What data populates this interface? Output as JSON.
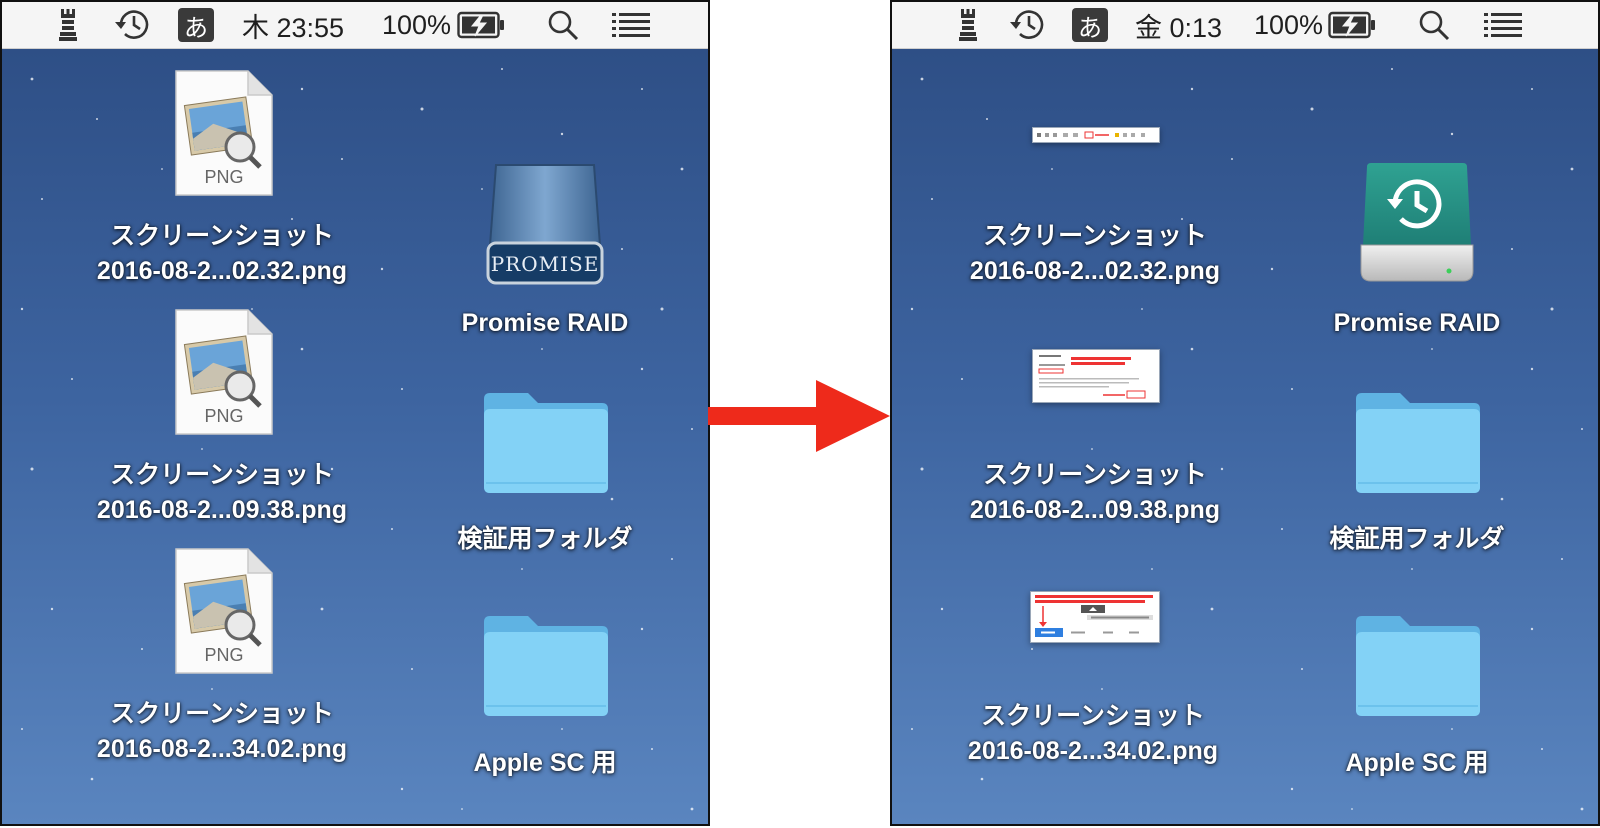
{
  "before": {
    "menubar": {
      "ime_label": "あ",
      "clock": "木 23:55",
      "battery_percent": "100%",
      "icons": [
        "tower-icon",
        "time-machine-icon",
        "ime-icon",
        "battery-charging-icon",
        "spotlight-search-icon",
        "notification-list-icon"
      ]
    },
    "files": [
      {
        "name_line1": "スクリーンショット",
        "name_line2": "2016-08-2...02.32.png",
        "type_label": "PNG"
      },
      {
        "name_line1": "スクリーンショット",
        "name_line2": "2016-08-2...09.38.png",
        "type_label": "PNG"
      },
      {
        "name_line1": "スクリーンショット",
        "name_line2": "2016-08-2...34.02.png",
        "type_label": "PNG"
      }
    ],
    "drive": {
      "label": "Promise RAID",
      "badge": "PROMISE"
    },
    "folders": [
      {
        "label": "検証用フォルダ"
      },
      {
        "label": "Apple SC 用"
      }
    ]
  },
  "after": {
    "menubar": {
      "ime_label": "あ",
      "clock": "金 0:13",
      "battery_percent": "100%",
      "icons": [
        "tower-icon",
        "time-machine-icon",
        "ime-icon",
        "battery-charging-icon",
        "spotlight-search-icon",
        "notification-list-icon"
      ]
    },
    "files": [
      {
        "name_line1": "スクリーンショット",
        "name_line2": "2016-08-2...02.32.png"
      },
      {
        "name_line1": "スクリーンショット",
        "name_line2": "2016-08-2...09.38.png"
      },
      {
        "name_line1": "スクリーンショット",
        "name_line2": "2016-08-2...34.02.png"
      }
    ],
    "drive": {
      "label": "Promise RAID"
    },
    "folders": [
      {
        "label": "検証用フォルダ"
      },
      {
        "label": "Apple SC 用"
      }
    ]
  },
  "colors": {
    "arrow": "#ee2a1b",
    "folder": "#7ecdf3",
    "timemachine": "#2a8a80"
  }
}
